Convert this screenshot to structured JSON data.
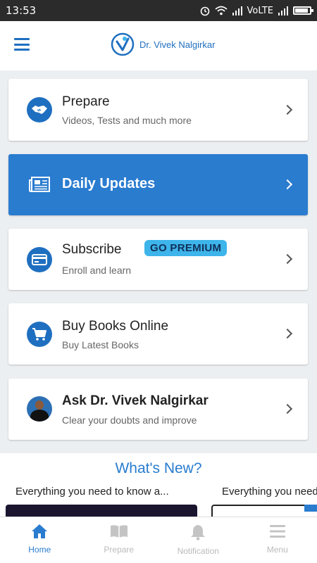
{
  "status_bar": {
    "time": "13:53",
    "network": "VoLTE"
  },
  "app_bar": {
    "brand_name": "Dr. Vivek Nalgirkar",
    "menu_icon": "hamburger-icon"
  },
  "cards": {
    "prepare": {
      "title": "Prepare",
      "subtitle": "Videos, Tests and much more",
      "icon": "handshake-icon"
    },
    "daily": {
      "title": "Daily Updates",
      "icon": "newspaper-icon"
    },
    "subscribe": {
      "title": "Subscribe",
      "badge": "GO PREMIUM",
      "subtitle": "Enroll and learn",
      "icon": "credit-card-icon"
    },
    "books": {
      "title": "Buy Books Online",
      "subtitle": "Buy Latest Books",
      "icon": "cart-icon"
    },
    "ask": {
      "title": "Ask Dr. Vivek Nalgirkar",
      "subtitle": "Clear your doubts and improve"
    }
  },
  "whats_new": {
    "heading": "What's New?",
    "items": [
      {
        "title": "Everything you need to know a..."
      },
      {
        "title": "Everything you need"
      }
    ]
  },
  "bottom_nav": [
    {
      "label": "Home",
      "icon": "home-icon",
      "active": true
    },
    {
      "label": "Prepare",
      "icon": "book-icon",
      "active": false
    },
    {
      "label": "Notification",
      "icon": "bell-icon",
      "active": false
    },
    {
      "label": "Menu",
      "icon": "menu-icon",
      "active": false
    }
  ],
  "colors": {
    "primary": "#2a7ccf",
    "badge": "#3db4ea",
    "nav_inactive": "#bbbbbb"
  }
}
